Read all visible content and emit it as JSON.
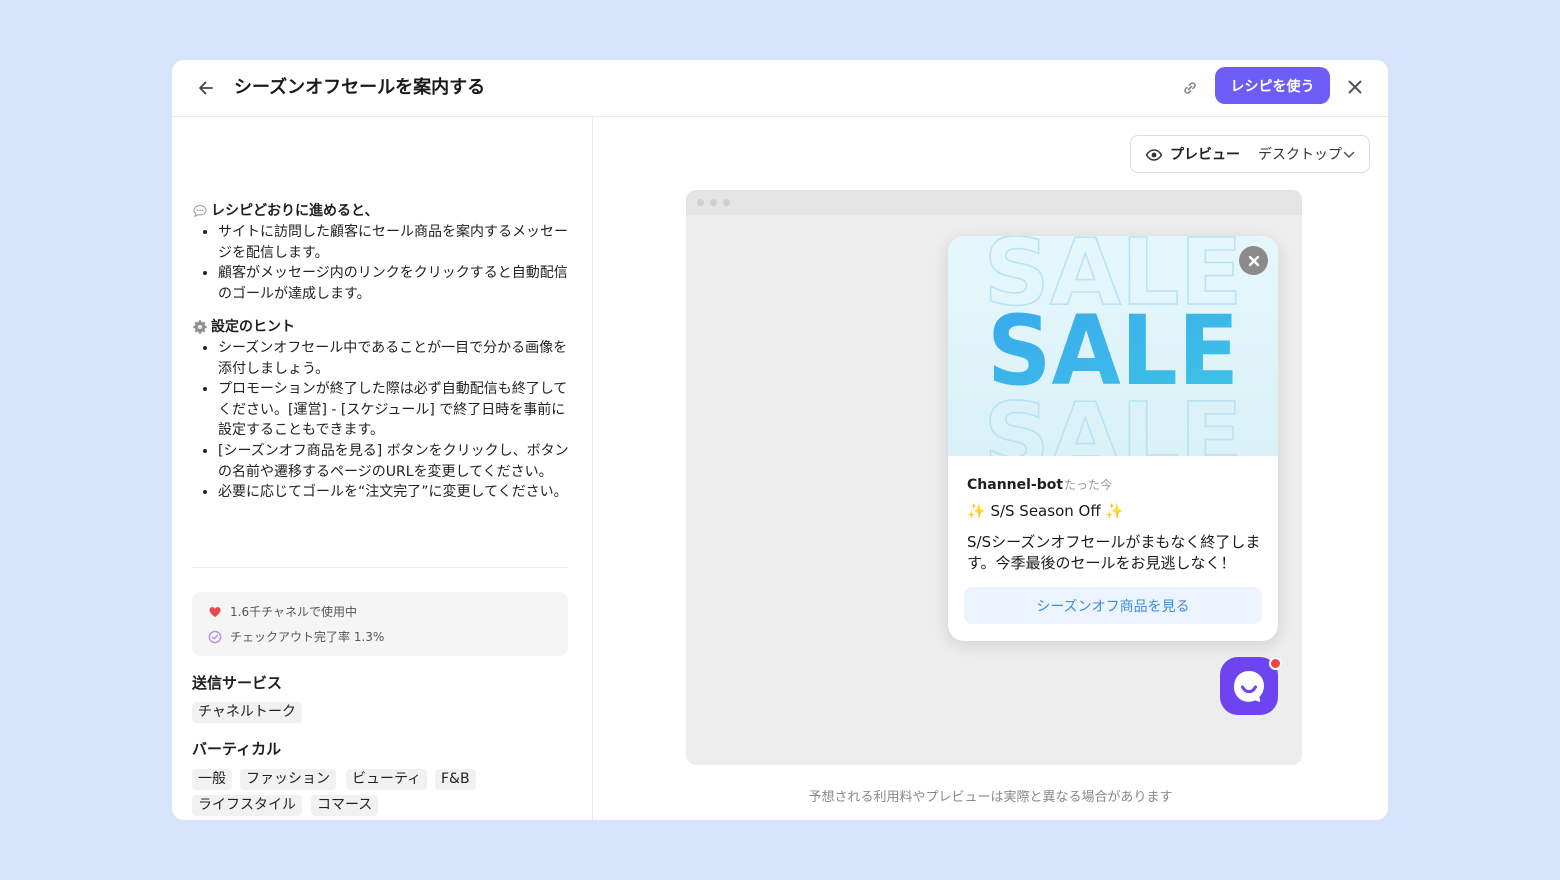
{
  "header": {
    "title": "シーズンオフセールを案内する",
    "use_recipe_label": "レシピを使う"
  },
  "left": {
    "intro_title": "レシピどおりに進めると、",
    "intro_items": [
      "サイトに訪問した顧客にセール商品を案内するメッセージを配信します。",
      "顧客がメッセージ内のリンクをクリックすると自動配信のゴールが達成します。"
    ],
    "hints_title": "設定のヒント",
    "hints_items": [
      "シーズンオフセール中であることが一目で分かる画像を添付しましょう。",
      "プロモーションが終了した際は必ず自動配信も終了してください。[運営] - [スケジュール] で終了日時を事前に設定することもできます。",
      "[シーズンオフ商品を見る] ボタンをクリックし、ボタンの名前や遷移するページのURLを変更してください。",
      "必要に応じてゴールを“注文完了”に変更してください。"
    ],
    "stats": {
      "usage": "1.6千チャネルで使用中",
      "checkout": "チェックアウト完了率 1.3%"
    },
    "service_title": "送信サービス",
    "services": [
      "チャネルトーク"
    ],
    "vertical_title": "バーティカル",
    "verticals": [
      "一般",
      "ファッション",
      "ビューティ",
      "F&B",
      "ライフスタイル",
      "コマース"
    ]
  },
  "preview": {
    "label": "プレビュー",
    "mode": "デスクトップ",
    "image_text": "SALE",
    "sender": "Channel-bot",
    "time": "たった今",
    "message_title": "✨ S/S Season Off ✨",
    "message_body": "S/Sシーズンオフセールがまもなく終了します。今季最後のセールをお見逃しなく！",
    "cta_label": "シーズンオフ商品を見る",
    "footnote": "予想される利用料やプレビューは実際と異なる場合があります"
  },
  "colors": {
    "accent": "#6d5cf6",
    "background": "#d6e4fc",
    "cta_bg": "#ebf4ff",
    "cta_text": "#3b8be0",
    "launcher": "#6d44f0",
    "badge": "#ef4444"
  }
}
